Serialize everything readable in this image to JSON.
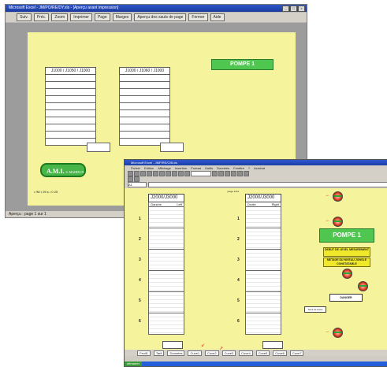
{
  "back_window": {
    "title": "Microsoft Excel - JM/PO/RE/DY.xls - [Aperçu avant impression]",
    "toolbar": [
      "Suiv.",
      "Préc.",
      "Zoom",
      "Imprimer",
      "Page",
      "Marges",
      "Aperçu des sauts de page",
      "Fermer",
      "Aide"
    ],
    "table_left_header": "J1000 / J1050 / J1000",
    "table_right_header": "J1000 / J1060 / J1000",
    "pompe_label": "POMPE 1",
    "ami_label": "A.M.I.",
    "ami_sub": "S. MAHIEUX",
    "footer": "• INI • 26 s • 0 25",
    "status": "Aperçu : page 1 sur 1"
  },
  "front_window": {
    "title": "Microsoft Excel - JMP/RE/CIB.xls",
    "menu": [
      "Fichier",
      "Edition",
      "Affichage",
      "Insertion",
      "Format",
      "Outils",
      "Données",
      "Fenêtre",
      "?",
      "Acrobat"
    ],
    "name_box": "A1",
    "zoom": "80%",
    "table_left": {
      "header": "J2000/J3000",
      "sub_left": "Gauche",
      "sub_right": "Left"
    },
    "table_right": {
      "header": "J2000/J3000",
      "sub_left": "Droite",
      "sub_right": "Right"
    },
    "row_label": "jauge à lire",
    "row_numbers": [
      "1",
      "2",
      "3",
      "4",
      "5",
      "6"
    ],
    "pompe_label": "POMPE 1",
    "yellow_boxes": [
      "DEBUT DE LEVEL MESUREMENT",
      "METAGE DU NIVEAU JONGLE CONSTATABLE"
    ],
    "dist_label": "DANGER",
    "gate_label": "Seuil de levée",
    "sheet_tabs": [
      "Feuil1",
      "Tarif",
      "Données",
      "Cuve1",
      "Cuve2",
      "Cuve3",
      "Cuve4",
      "Cuve5",
      "Cuve6",
      "Cuve7"
    ],
    "start_label": "démarrer"
  }
}
